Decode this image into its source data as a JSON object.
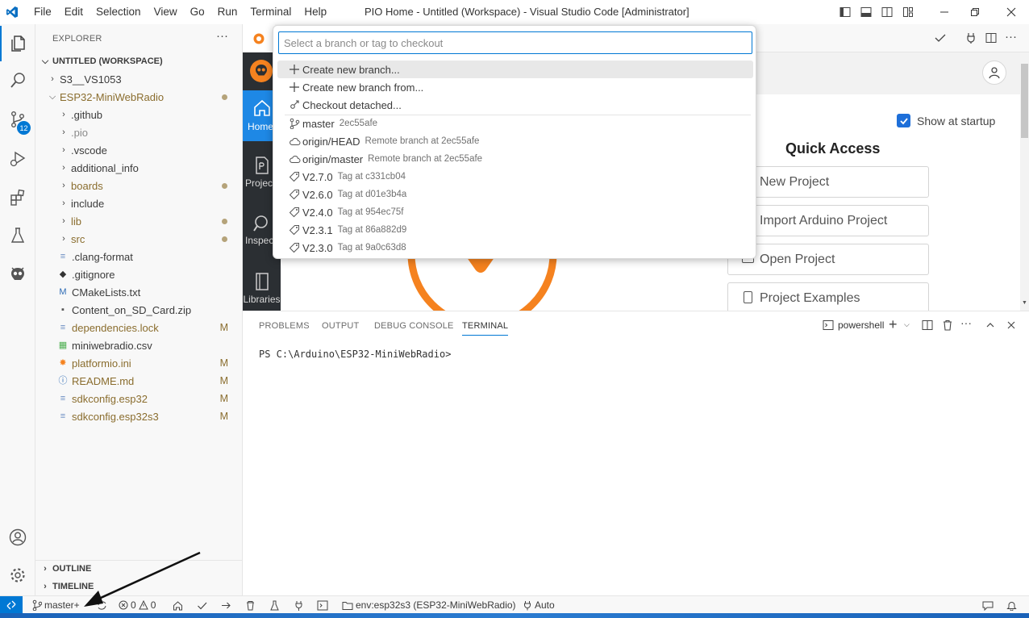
{
  "window": {
    "title": "PIO Home - Untitled (Workspace) - Visual Studio Code [Administrator]",
    "menu": [
      "File",
      "Edit",
      "Selection",
      "View",
      "Go",
      "Run",
      "Terminal",
      "Help"
    ]
  },
  "activity": {
    "scm_badge": "12"
  },
  "explorer": {
    "header": "EXPLORER",
    "more": "···",
    "workspace": "UNTITLED (WORKSPACE)",
    "items": [
      {
        "label": "S3__VS1053",
        "kind": "folder",
        "level": 1,
        "expanded": false
      },
      {
        "label": "ESP32-MiniWebRadio",
        "kind": "folder",
        "level": 1,
        "expanded": true,
        "decor": "dot",
        "color": "#8a6d2e"
      },
      {
        "label": ".github",
        "kind": "folder",
        "level": 2
      },
      {
        "label": ".pio",
        "kind": "folder",
        "level": 2,
        "color": "#8a8a8a"
      },
      {
        "label": ".vscode",
        "kind": "folder",
        "level": 2
      },
      {
        "label": "additional_info",
        "kind": "folder",
        "level": 2
      },
      {
        "label": "boards",
        "kind": "folder",
        "level": 2,
        "decor": "dot",
        "color": "#8a6d2e"
      },
      {
        "label": "include",
        "kind": "folder",
        "level": 2
      },
      {
        "label": "lib",
        "kind": "folder",
        "level": 2,
        "decor": "dot",
        "color": "#8a6d2e"
      },
      {
        "label": "src",
        "kind": "folder",
        "level": 2,
        "decor": "dot",
        "color": "#8a6d2e"
      },
      {
        "label": ".clang-format",
        "kind": "file",
        "icon": "lines",
        "level": 2
      },
      {
        "label": ".gitignore",
        "kind": "file",
        "icon": "git",
        "level": 2
      },
      {
        "label": "CMakeLists.txt",
        "kind": "file",
        "icon": "M",
        "level": 2
      },
      {
        "label": "Content_on_SD_Card.zip",
        "kind": "file",
        "icon": "zip",
        "level": 2
      },
      {
        "label": "dependencies.lock",
        "kind": "file",
        "icon": "lines",
        "level": 2,
        "decor": "M",
        "color": "#8a6d2e"
      },
      {
        "label": "miniwebradio.csv",
        "kind": "file",
        "icon": "csv",
        "level": 2
      },
      {
        "label": "platformio.ini",
        "kind": "file",
        "icon": "pio",
        "level": 2,
        "decor": "M",
        "color": "#8a6d2e"
      },
      {
        "label": "README.md",
        "kind": "file",
        "icon": "info",
        "level": 2,
        "decor": "M",
        "color": "#8a6d2e"
      },
      {
        "label": "sdkconfig.esp32",
        "kind": "file",
        "icon": "lines",
        "level": 2,
        "decor": "M",
        "color": "#8a6d2e"
      },
      {
        "label": "sdkconfig.esp32s3",
        "kind": "file",
        "icon": "lines",
        "level": 2,
        "decor": "M",
        "color": "#8a6d2e"
      }
    ],
    "outline": "OUTLINE",
    "timeline": "TIMELINE"
  },
  "pio": {
    "nav": [
      "Home",
      "Projects",
      "Inspect",
      "Libraries"
    ],
    "show_at_startup": "Show at startup",
    "quick_access_title": "Quick Access",
    "quick_access": [
      "New Project",
      "Import Arduino Project",
      "Open Project",
      "Project Examples"
    ]
  },
  "quickpick": {
    "placeholder": "Select a branch or tag to checkout",
    "actions": [
      "Create new branch...",
      "Create new branch from...",
      "Checkout detached..."
    ],
    "refs": [
      {
        "name": "master",
        "desc": "2ec55afe",
        "icon": "branch"
      },
      {
        "name": "origin/HEAD",
        "desc": "Remote branch at 2ec55afe",
        "icon": "cloud"
      },
      {
        "name": "origin/master",
        "desc": "Remote branch at 2ec55afe",
        "icon": "cloud"
      },
      {
        "name": "V2.7.0",
        "desc": "Tag at c331cb04",
        "icon": "tag"
      },
      {
        "name": "V2.6.0",
        "desc": "Tag at d01e3b4a",
        "icon": "tag"
      },
      {
        "name": "V2.4.0",
        "desc": "Tag at 954ec75f",
        "icon": "tag"
      },
      {
        "name": "V2.3.1",
        "desc": "Tag at 86a882d9",
        "icon": "tag"
      },
      {
        "name": "V2.3.0",
        "desc": "Tag at 9a0c63d8",
        "icon": "tag"
      }
    ]
  },
  "panel": {
    "tabs": [
      "PROBLEMS",
      "OUTPUT",
      "DEBUG CONSOLE",
      "TERMINAL"
    ],
    "active_tab": "TERMINAL",
    "shell": "powershell",
    "prompt": "PS C:\\Arduino\\ESP32-MiniWebRadio>"
  },
  "status": {
    "branch": "master+",
    "errors": "0",
    "warnings": "0",
    "env": "env:esp32s3 (ESP32-MiniWebRadio)",
    "port": "Auto"
  },
  "colors": {
    "accent": "#0078d4",
    "pio_orange": "#f5821f",
    "status_remote": "#0078d4"
  }
}
